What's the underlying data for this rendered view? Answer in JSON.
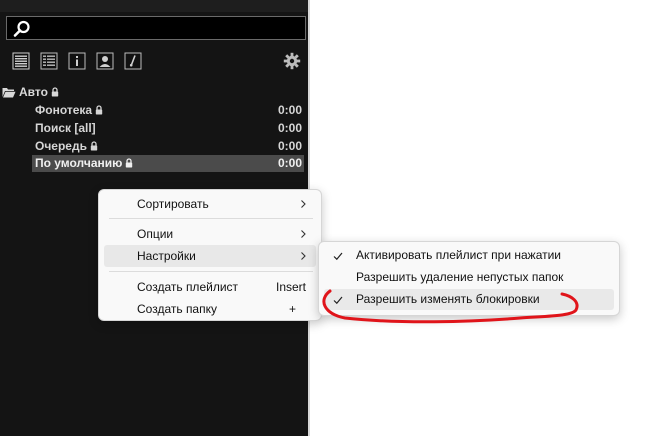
{
  "search": {
    "value": "",
    "placeholder": ""
  },
  "toolbar": {
    "icons": [
      "list-view-icon",
      "detail-view-icon",
      "info-icon",
      "artist-icon",
      "lyrics-icon",
      "gear-icon"
    ]
  },
  "tree": {
    "folder": {
      "label": "Авто",
      "icon": "folder-open-icon",
      "locked": true
    },
    "items": [
      {
        "label": "Фонотека",
        "locked": true,
        "duration": "0:00",
        "selected": false
      },
      {
        "label": "Поиск [all]",
        "locked": false,
        "duration": "0:00",
        "selected": false
      },
      {
        "label": "Очередь",
        "locked": true,
        "duration": "0:00",
        "selected": false
      },
      {
        "label": "По умолчанию",
        "locked": true,
        "duration": "0:00",
        "selected": true
      }
    ]
  },
  "context_menu": {
    "items": [
      {
        "label": "Сортировать",
        "submenu": true,
        "shortcut": ""
      },
      {
        "label": "Опции",
        "submenu": true,
        "shortcut": ""
      },
      {
        "label": "Настройки",
        "submenu": true,
        "shortcut": "",
        "hovered": true
      },
      {
        "label": "Создать плейлист",
        "submenu": false,
        "shortcut": "Insert"
      },
      {
        "label": "Создать папку",
        "submenu": false,
        "shortcut": "+"
      }
    ]
  },
  "submenu": {
    "items": [
      {
        "label": "Активировать плейлист при нажатии",
        "checked": true
      },
      {
        "label": "Разрешить удаление непустых папок",
        "checked": false
      },
      {
        "label": "Разрешить изменять блокировки",
        "checked": true,
        "hovered": true
      }
    ]
  },
  "colors": {
    "panel_bg": "#141414",
    "selected_row": "#4b4b4b",
    "menu_bg": "#f9f9f9",
    "annotation": "#e0141a"
  }
}
